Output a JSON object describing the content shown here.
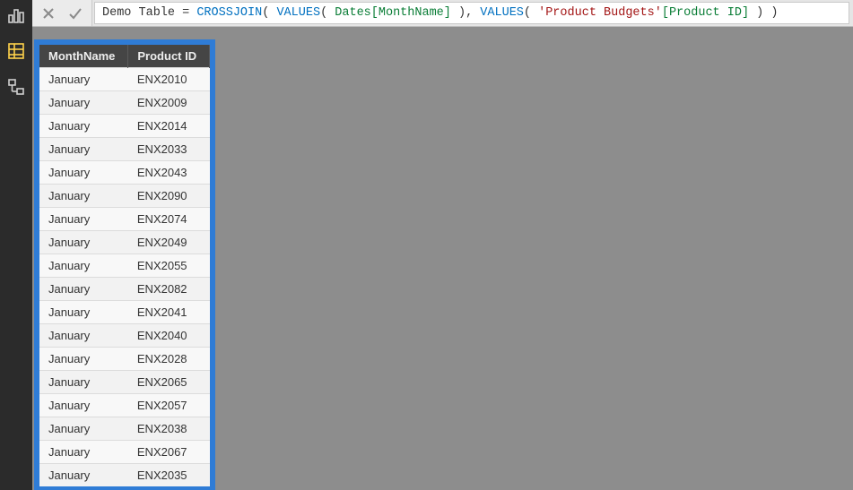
{
  "formula": {
    "prefix": "Demo Table = ",
    "fn1": "CROSSJOIN",
    "p1": "( ",
    "fn2": "VALUES",
    "p2": "( ",
    "col1": "Dates[MonthName]",
    "p3": " ), ",
    "fn3": "VALUES",
    "p4": "( ",
    "str1": "'Product Budgets'",
    "col2": "[Product ID]",
    "p5": " ) )"
  },
  "table": {
    "headers": [
      "MonthName",
      "Product ID"
    ],
    "rows": [
      [
        "January",
        "ENX2010"
      ],
      [
        "January",
        "ENX2009"
      ],
      [
        "January",
        "ENX2014"
      ],
      [
        "January",
        "ENX2033"
      ],
      [
        "January",
        "ENX2043"
      ],
      [
        "January",
        "ENX2090"
      ],
      [
        "January",
        "ENX2074"
      ],
      [
        "January",
        "ENX2049"
      ],
      [
        "January",
        "ENX2055"
      ],
      [
        "January",
        "ENX2082"
      ],
      [
        "January",
        "ENX2041"
      ],
      [
        "January",
        "ENX2040"
      ],
      [
        "January",
        "ENX2028"
      ],
      [
        "January",
        "ENX2065"
      ],
      [
        "January",
        "ENX2057"
      ],
      [
        "January",
        "ENX2038"
      ],
      [
        "January",
        "ENX2067"
      ],
      [
        "January",
        "ENX2035"
      ]
    ]
  }
}
